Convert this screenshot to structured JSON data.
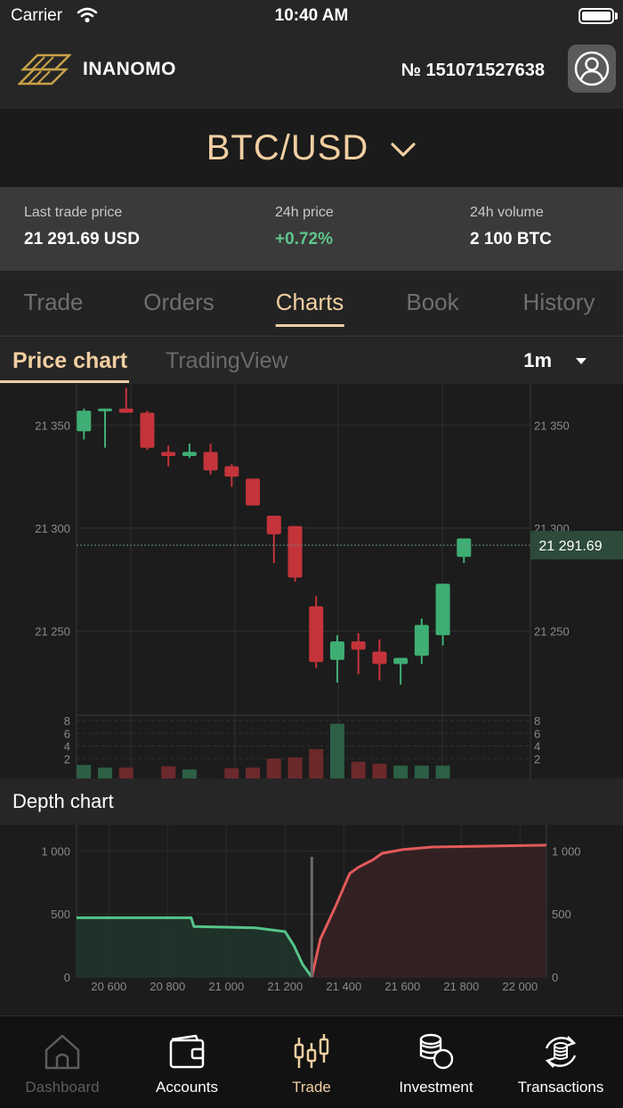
{
  "status_bar": {
    "carrier": "Carrier",
    "time": "10:40 AM"
  },
  "header": {
    "app_name": "INANOMO",
    "account_number": "№ 151071527638"
  },
  "pair": {
    "label": "BTC/USD"
  },
  "stats": [
    {
      "label": "Last trade price",
      "value": "21 291.69 USD"
    },
    {
      "label": "24h price",
      "value": "+0.72%"
    },
    {
      "label": "24h volume",
      "value": "2 100 BTC"
    }
  ],
  "tabs": [
    "Trade",
    "Orders",
    "Charts",
    "Book",
    "History"
  ],
  "active_tab": "Charts",
  "subtabs": {
    "price_chart": "Price chart",
    "tradingview": "TradingView",
    "interval": "1m"
  },
  "depth_title": "Depth chart",
  "nav": [
    {
      "label": "Dashboard",
      "icon": "home-icon"
    },
    {
      "label": "Accounts",
      "icon": "wallet-icon"
    },
    {
      "label": "Trade",
      "icon": "candlestick-icon"
    },
    {
      "label": "Investment",
      "icon": "coins-icon"
    },
    {
      "label": "Transactions",
      "icon": "refresh-coins-icon"
    }
  ],
  "colors": {
    "accent": "#f2cfa2",
    "up": "#3fae74",
    "down": "#c4343a",
    "positive_text": "#5fc58d"
  },
  "chart_data": [
    {
      "type": "candlestick",
      "title": "Price chart",
      "y_ticks": [
        "21 350",
        "21 300",
        "21 250"
      ],
      "ylim": [
        21210,
        21370
      ],
      "last_price_label": "21 291.69",
      "last_price": 21291.69,
      "candles": [
        {
          "o": 21347,
          "h": 21358,
          "l": 21343,
          "c": 21357
        },
        {
          "o": 21357,
          "h": 21358,
          "l": 21339,
          "c": 21358
        },
        {
          "o": 21358,
          "h": 21368,
          "l": 21356,
          "c": 21356
        },
        {
          "o": 21356,
          "h": 21357,
          "l": 21338,
          "c": 21339
        },
        {
          "o": 21337,
          "h": 21340,
          "l": 21330,
          "c": 21335
        },
        {
          "o": 21335,
          "h": 21341,
          "l": 21334,
          "c": 21337
        },
        {
          "o": 21337,
          "h": 21341,
          "l": 21326,
          "c": 21328
        },
        {
          "o": 21330,
          "h": 21331,
          "l": 21320,
          "c": 21325
        },
        {
          "o": 21324,
          "h": 21324,
          "l": 21311,
          "c": 21311
        },
        {
          "o": 21306,
          "h": 21306,
          "l": 21283,
          "c": 21297
        },
        {
          "o": 21301,
          "h": 21301,
          "l": 21274,
          "c": 21276
        },
        {
          "o": 21262,
          "h": 21267,
          "l": 21232,
          "c": 21235
        },
        {
          "o": 21236,
          "h": 21248,
          "l": 21225,
          "c": 21245
        },
        {
          "o": 21245,
          "h": 21249,
          "l": 21229,
          "c": 21241
        },
        {
          "o": 21240,
          "h": 21246,
          "l": 21226,
          "c": 21234
        },
        {
          "o": 21234,
          "h": 21236,
          "l": 21224,
          "c": 21237
        },
        {
          "o": 21238,
          "h": 21256,
          "l": 21234,
          "c": 21253
        },
        {
          "o": 21248,
          "h": 21273,
          "l": 21243,
          "c": 21273
        },
        {
          "o": 21286,
          "h": 21295,
          "l": 21283,
          "c": 21295
        }
      ],
      "volume_ticks": [
        "8",
        "6",
        "4",
        "2"
      ],
      "volume_ylim": [
        0,
        8
      ],
      "volumes": [
        1.0,
        0.6,
        0.6,
        0.0,
        0.8,
        0.3,
        0.0,
        0.5,
        0.6,
        2.0,
        2.2,
        3.5,
        7.5,
        1.5,
        1.2,
        0.9,
        0.9,
        0.9,
        0.0
      ]
    },
    {
      "type": "area",
      "title": "Depth chart",
      "x_ticks": [
        "20 600",
        "20 800",
        "21 000",
        "21 200",
        "21 400",
        "21 600",
        "21 800",
        "22 000"
      ],
      "x_tick_values": [
        20600,
        20800,
        21000,
        21200,
        21400,
        21600,
        21800,
        22000
      ],
      "xlim": [
        20490,
        22090
      ],
      "y_ticks": [
        "1 000",
        "500",
        "0"
      ],
      "y_tick_values": [
        1000,
        500,
        0
      ],
      "ylim": [
        0,
        1150
      ],
      "mid_price": 21291,
      "bids": {
        "x": [
          20490,
          20880,
          20890,
          21100,
          21200,
          21230,
          21260,
          21291
        ],
        "y": [
          470,
          470,
          400,
          390,
          360,
          250,
          100,
          0
        ]
      },
      "asks": {
        "x": [
          21291,
          21320,
          21370,
          21420,
          21450,
          21500,
          21530,
          21600,
          21700,
          22090
        ],
        "y": [
          0,
          300,
          550,
          820,
          870,
          930,
          980,
          1010,
          1030,
          1045
        ]
      }
    }
  ]
}
